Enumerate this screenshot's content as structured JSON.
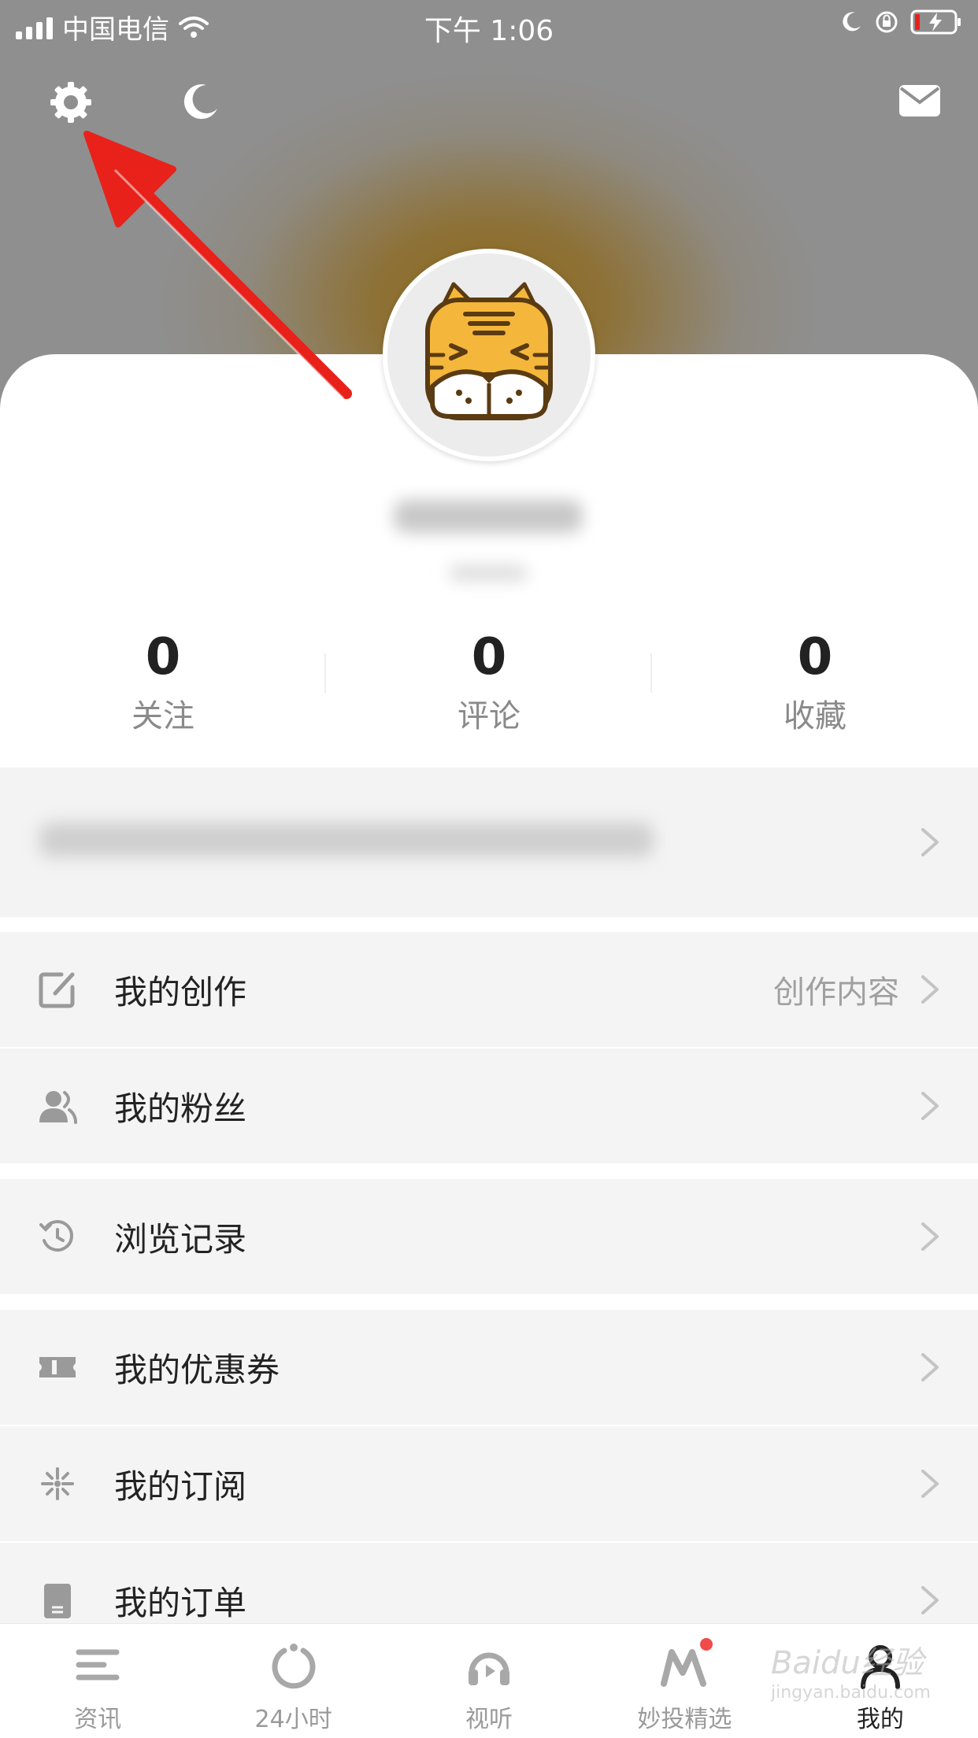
{
  "status_bar": {
    "carrier": "中国电信",
    "time": "下午 1:06"
  },
  "header": {
    "settings_icon": "gear-icon",
    "night_mode_icon": "moon-icon",
    "messages_icon": "mail-icon"
  },
  "profile": {
    "avatar": "tiger-avatar"
  },
  "stats": [
    {
      "value": "0",
      "label": "关注"
    },
    {
      "value": "0",
      "label": "评论"
    },
    {
      "value": "0",
      "label": "收藏"
    }
  ],
  "menu": [
    {
      "label": "我的创作",
      "hint": "创作内容",
      "icon": "edit-icon"
    },
    {
      "label": "我的粉丝",
      "hint": "",
      "icon": "fans-icon"
    },
    {
      "label": "浏览记录",
      "hint": "",
      "icon": "history-icon"
    },
    {
      "label": "我的优惠券",
      "hint": "",
      "icon": "coupon-icon"
    },
    {
      "label": "我的订阅",
      "hint": "",
      "icon": "subscribe-icon"
    },
    {
      "label": "我的订单",
      "hint": "",
      "icon": "order-icon"
    }
  ],
  "tabs": [
    {
      "label": "资讯",
      "icon": "news-icon"
    },
    {
      "label": "24小时",
      "icon": "refresh-icon"
    },
    {
      "label": "视听",
      "icon": "headphones-icon"
    },
    {
      "label": "妙投精选",
      "icon": "m-logo-icon"
    },
    {
      "label": "我的",
      "icon": "person-icon"
    }
  ],
  "watermark": {
    "brand": "Baidu经验",
    "url": "jingyan.baidu.com"
  },
  "colors": {
    "accent_red": "#e8221b",
    "badge": "#f04a4a",
    "hero_gold": "#8e6a1f"
  }
}
